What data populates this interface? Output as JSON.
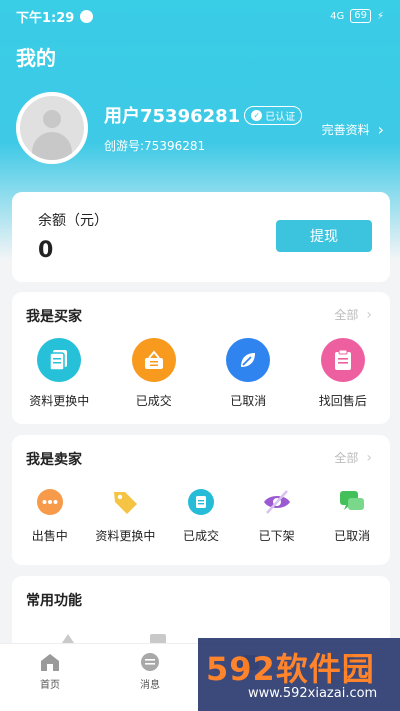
{
  "status": {
    "time": "下午1:29",
    "battery": "69",
    "network": "4G"
  },
  "header": {
    "title": "我的"
  },
  "profile": {
    "username": "用户75396281",
    "verified": "已认证",
    "id_label": "创游号:75396281",
    "complete_label": "完善资料"
  },
  "balance": {
    "label": "余额（元）",
    "value": "0",
    "withdraw": "提现"
  },
  "buyer": {
    "title": "我是买家",
    "all": "全部",
    "items": [
      {
        "label": "资料更换中",
        "icon": "document-icon",
        "color": "#26c0d9"
      },
      {
        "label": "已成交",
        "icon": "cart-icon",
        "color": "#f79a1e"
      },
      {
        "label": "已取消",
        "icon": "cancel-icon",
        "color": "#2f84f0"
      },
      {
        "label": "找回售后",
        "icon": "clipboard-icon",
        "color": "#ee5fa0"
      }
    ]
  },
  "seller": {
    "title": "我是卖家",
    "all": "全部",
    "items": [
      {
        "label": "出售中",
        "icon": "more-icon",
        "color": "#f79a4a"
      },
      {
        "label": "资料更换中",
        "icon": "tag-icon",
        "color": "#f6c444"
      },
      {
        "label": "已成交",
        "icon": "document-icon",
        "color": "#26bcd8"
      },
      {
        "label": "已下架",
        "icon": "hidden-icon",
        "color": "#9b5ad1"
      },
      {
        "label": "已取消",
        "icon": "chat-icon",
        "color": "#44c05a"
      }
    ]
  },
  "common": {
    "title": "常用功能"
  },
  "tabs": [
    {
      "label": "首页",
      "icon": "home-icon"
    },
    {
      "label": "消息",
      "icon": "message-icon"
    },
    {
      "label": "",
      "icon": "publish-icon"
    },
    {
      "label": "",
      "icon": "mine-icon"
    }
  ],
  "watermark": {
    "brand": "592软件园",
    "url": "www.592xiazai.com"
  }
}
